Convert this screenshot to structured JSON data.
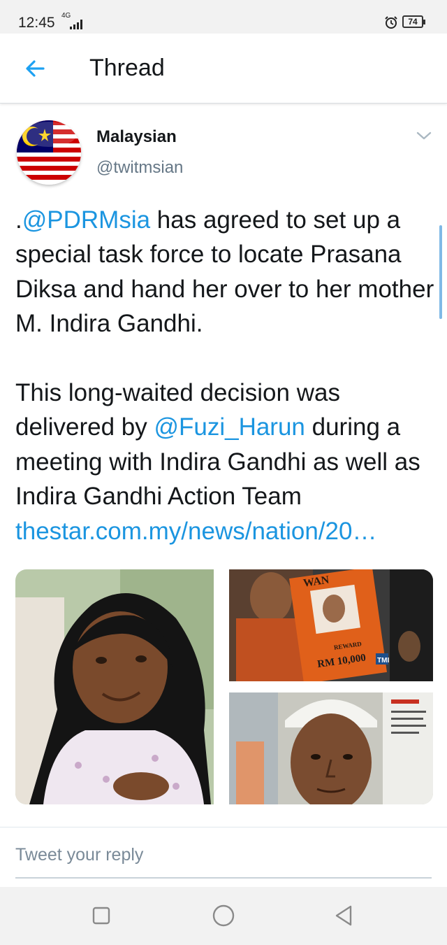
{
  "status_bar": {
    "time": "12:45",
    "network": "4G",
    "battery": "74",
    "icons": [
      "signal-icon",
      "alarm-icon",
      "battery-icon"
    ]
  },
  "header": {
    "title": "Thread",
    "back_icon": "back-arrow-icon"
  },
  "tweet": {
    "display_name": "Malaysian",
    "handle": "@twitmsian",
    "menu_icon": "chevron-down-icon",
    "p1_prefix": ".",
    "mention_1": "@PDRMsia",
    "p1_rest": " has agreed to set up a special task force to locate Prasana Diksa and hand her over to her mother M. Indira Gandhi.",
    "p2_a": "This long-waited decision was delivered by ",
    "mention_2": "@Fuzi_Harun",
    "p2_b": " during a meeting with Indira Gandhi as well as Indira Gandhi Action Team ",
    "url": "thestar.com.my/news/nation/20…"
  },
  "media": {
    "tiles": [
      "photo-girl-in-hijab",
      "photo-wanted-poster",
      "photo-man-portrait"
    ],
    "poster_title": "WAN",
    "poster_reward": "REWARD",
    "poster_amount": "RM 10,000",
    "watermark": "TMI"
  },
  "reply": {
    "placeholder": "Tweet your reply"
  },
  "nav": {
    "icons": [
      "recent-apps-icon",
      "home-icon",
      "back-icon"
    ]
  },
  "colors": {
    "link": "#1b95e0",
    "text": "#14171a",
    "secondary": "#657786",
    "bar_background": "#f2f2f2"
  }
}
